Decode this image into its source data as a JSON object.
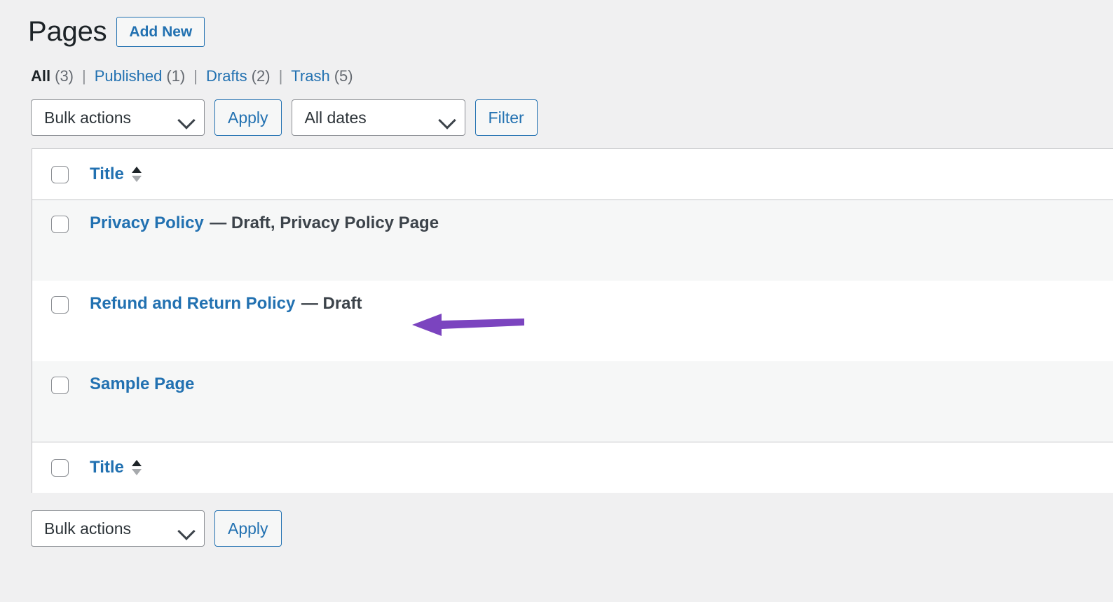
{
  "header": {
    "title": "Pages",
    "add_new_label": "Add New"
  },
  "status_filters": [
    {
      "label": "All",
      "count": "(3)",
      "current": true
    },
    {
      "label": "Published",
      "count": "(1)",
      "current": false
    },
    {
      "label": "Drafts",
      "count": "(2)",
      "current": false
    },
    {
      "label": "Trash",
      "count": "(5)",
      "current": false
    }
  ],
  "separator": "|",
  "tablenav_top": {
    "bulk_actions_value": "Bulk actions",
    "apply_label": "Apply",
    "dates_value": "All dates",
    "filter_label": "Filter"
  },
  "tablenav_bottom": {
    "bulk_actions_value": "Bulk actions",
    "apply_label": "Apply"
  },
  "table": {
    "title_column_header": "Title",
    "title_column_footer": "Title",
    "rows": [
      {
        "title": "Privacy Policy",
        "state": "— Draft, Privacy Policy Page",
        "alternate": true
      },
      {
        "title": "Refund and Return Policy",
        "state": "— Draft",
        "alternate": false
      },
      {
        "title": "Sample Page",
        "state": "",
        "alternate": true
      }
    ]
  },
  "annotation": {
    "arrow_color": "#7b44bf",
    "points_to": "Refund and Return Policy"
  },
  "colors": {
    "link": "#2271b1",
    "text": "#1d2327",
    "muted": "#646970",
    "background": "#f0f0f1",
    "row_alternate": "#f6f7f7",
    "border": "#c3c4c7"
  }
}
